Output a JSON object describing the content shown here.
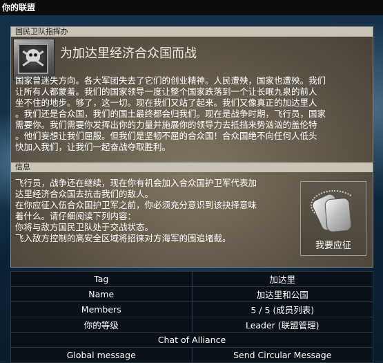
{
  "window": {
    "title": "你的联盟"
  },
  "header": {
    "label": "国民卫队指挥办"
  },
  "motto": "为加达里经济合众国而战",
  "intro_text": "国家曾迷失方向。各大军团失去了它们的创业精神。人民遭殃，国家也遭殃。我们\n让所有人都蒙羞。我们的国家领导一度让整个国家跌落到一个让长眠九泉的前人\n坐不住的地步。够了，这一切。现在我们又站了起来。我们又像真正的加达里人\n。我们还是合众国，我们的国土最终都会归我们。现在是战争时期，飞行员，国家\n需要你。我们需要你发挥出你的力量并施展你的领导力去抵挡来势汹汹的盖伦特\n。他们妄想让我们屈服。但我们是坚韧不屈的合众国！合众国绝不向任何人低头\n快加入我们，让我们一起奋战夺取胜利。",
  "info_header": "信息",
  "info_text": "飞行员，战争还在继续，现在你有机会加入合众国护卫军代表加\n达里经济合众国去抗击我们的敌人。\n在你应征入伍合众国护卫军之前，你必须充分意识到该抉择意味\n着什么。请仔细阅读下列内容：\n你将与敌方国民卫队处于交战状态。\n飞入敌方控制的高安全区域将招徕对方海军的围追堵截。",
  "join_button": {
    "label": "我要应征",
    "icon": "dogtags-icon"
  },
  "rows": {
    "tag": {
      "label": "Tag",
      "value": "加达里"
    },
    "name": {
      "label": "Name",
      "value": "加达里和公国"
    },
    "members": {
      "label": "Members",
      "value": "5 / 5 (成员列表)"
    },
    "rank": {
      "label": "你的等级",
      "value": "Leader (联盟管理)"
    },
    "chat": {
      "label": "Chat of Alliance"
    },
    "actions": {
      "global": "Global message",
      "circular": "Send Circular Message"
    }
  }
}
